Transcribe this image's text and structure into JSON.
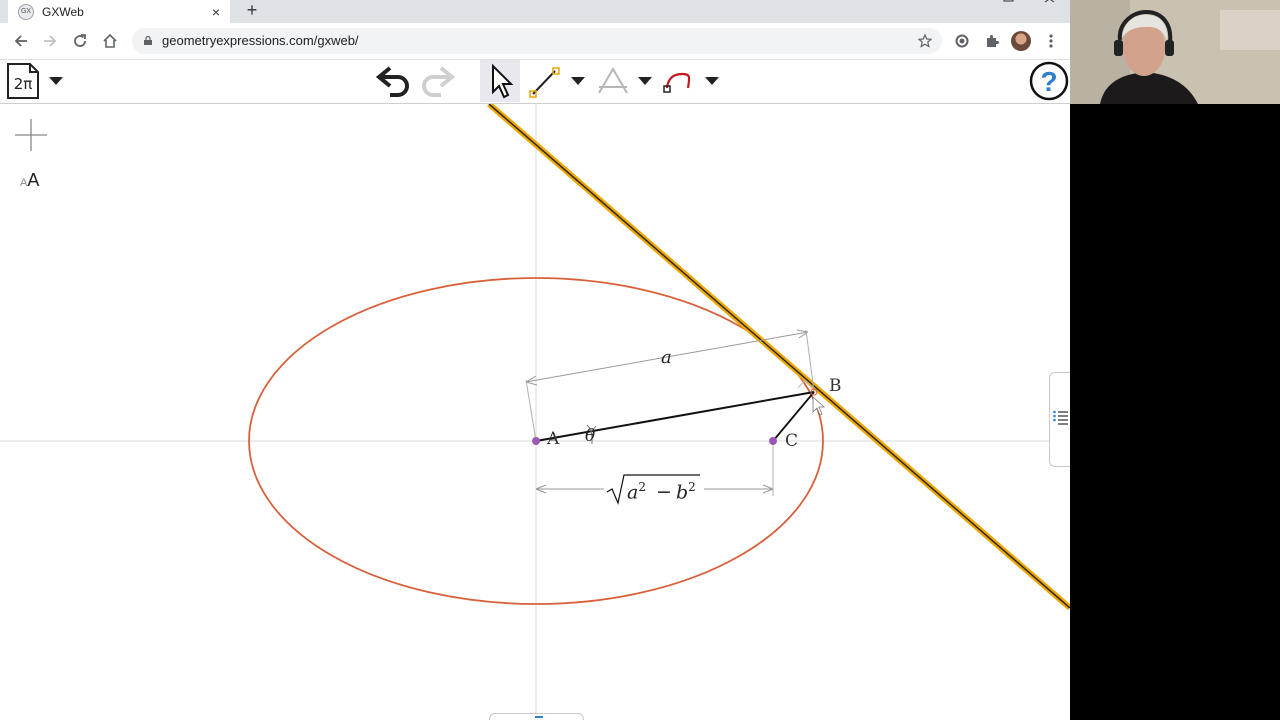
{
  "browser": {
    "tab_title": "GXWeb",
    "favicon_text": "GX",
    "tab_close": "×",
    "new_tab": "+",
    "url": "geometryexpressions.com/gxweb/"
  },
  "app": {
    "doc_button_label": "2π",
    "font_size_small": "A",
    "font_size_large": "A"
  },
  "drawing": {
    "point_A": "A",
    "point_B": "B",
    "point_C": "C",
    "dim_a": "a",
    "angle_theta": "θ",
    "dim_sqrt_a": "a",
    "dim_sqrt_exp1": "2",
    "dim_sqrt_minus": "−",
    "dim_sqrt_b": "b",
    "dim_sqrt_exp2": "2"
  },
  "colors": {
    "ellipse": "#d9603a",
    "tangent_line": "#f0a800",
    "point": "#9b59b6",
    "help": "#2f7fd0"
  },
  "icons": {
    "doc": "document-icon",
    "undo": "undo-icon",
    "redo": "redo-icon",
    "select": "arrow-cursor-icon",
    "draw_line": "line-tool-icon",
    "constrain": "constraint-icon",
    "curve": "curve-tool-icon",
    "help": "help-icon"
  }
}
